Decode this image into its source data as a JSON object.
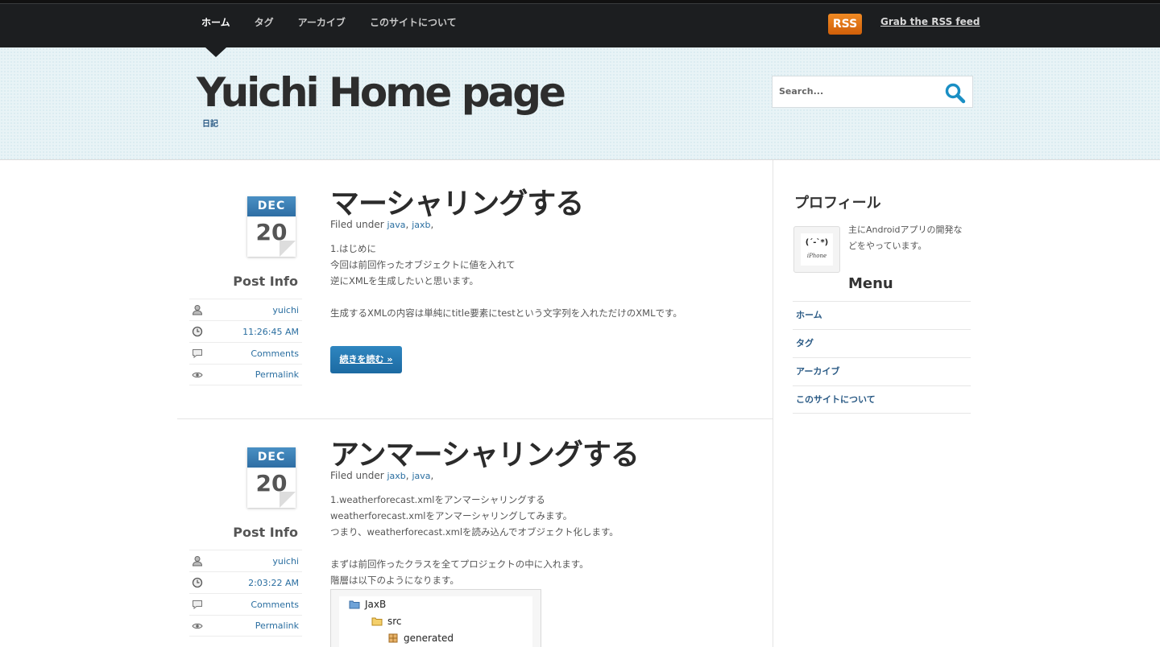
{
  "nav": {
    "items": [
      {
        "label": "ホーム"
      },
      {
        "label": "タグ"
      },
      {
        "label": "アーカイブ"
      },
      {
        "label": "このサイトについて"
      }
    ],
    "rss_badge": "RSS",
    "rss_text": "Grab the RSS feed"
  },
  "header": {
    "title": "Yuichi Home page",
    "description": "日記",
    "search_placeholder": "Search..."
  },
  "posts": [
    {
      "title": "マーシャリングする",
      "month": "DEC",
      "day": "20",
      "post_info_title": "Post Info",
      "author": "yuichi",
      "time": "11:26:45 AM",
      "comments": "Comments",
      "permalink": "Permalink",
      "filed_under": "Filed under",
      "tags": [
        "java",
        "jaxb"
      ],
      "body": [
        "1.はじめに",
        "今回は前回作ったオブジェクトに値を入れて",
        "逆にXMLを生成したいと思います。",
        "",
        "生成するXMLの内容は単純にtitle要素にtestという文字列を入れただけのXMLです。"
      ],
      "read_more": "続きを読む »"
    },
    {
      "title": "アンマーシャリングする",
      "month": "DEC",
      "day": "20",
      "post_info_title": "Post Info",
      "author": "yuichi",
      "time": "2:03:22 AM",
      "comments": "Comments",
      "permalink": "Permalink",
      "filed_under": "Filed under",
      "tags": [
        "jaxb",
        "java"
      ],
      "body": [
        "1.weatherforecast.xmlをアンマーシャリングする",
        "weatherforecast.xmlをアンマーシャリングしてみます。",
        "つまり、weatherforecast.xmlを読み込んでオブジェクト化します。",
        "",
        "まずは前回作ったクラスを全てプロジェクトの中に入れます。",
        "階層は以下のようになります。"
      ],
      "tree": [
        "JaxB",
        "src",
        "generated"
      ]
    }
  ],
  "sidebar": {
    "profile_title": "プロフィール",
    "avatar_face": "(´-`*)",
    "avatar_sub": "iPhone",
    "profile_text": "主にAndroidアプリの開発などをやっています。",
    "menu_title": "Menu",
    "menu": [
      "ホーム",
      "タグ",
      "アーカイブ",
      "このサイトについて"
    ]
  },
  "colors": {
    "topbar": "#1c1e20",
    "header_bg": "#e8f3f6",
    "accent_blue": "#2a6ea0",
    "rss_orange": "#e4761a"
  }
}
